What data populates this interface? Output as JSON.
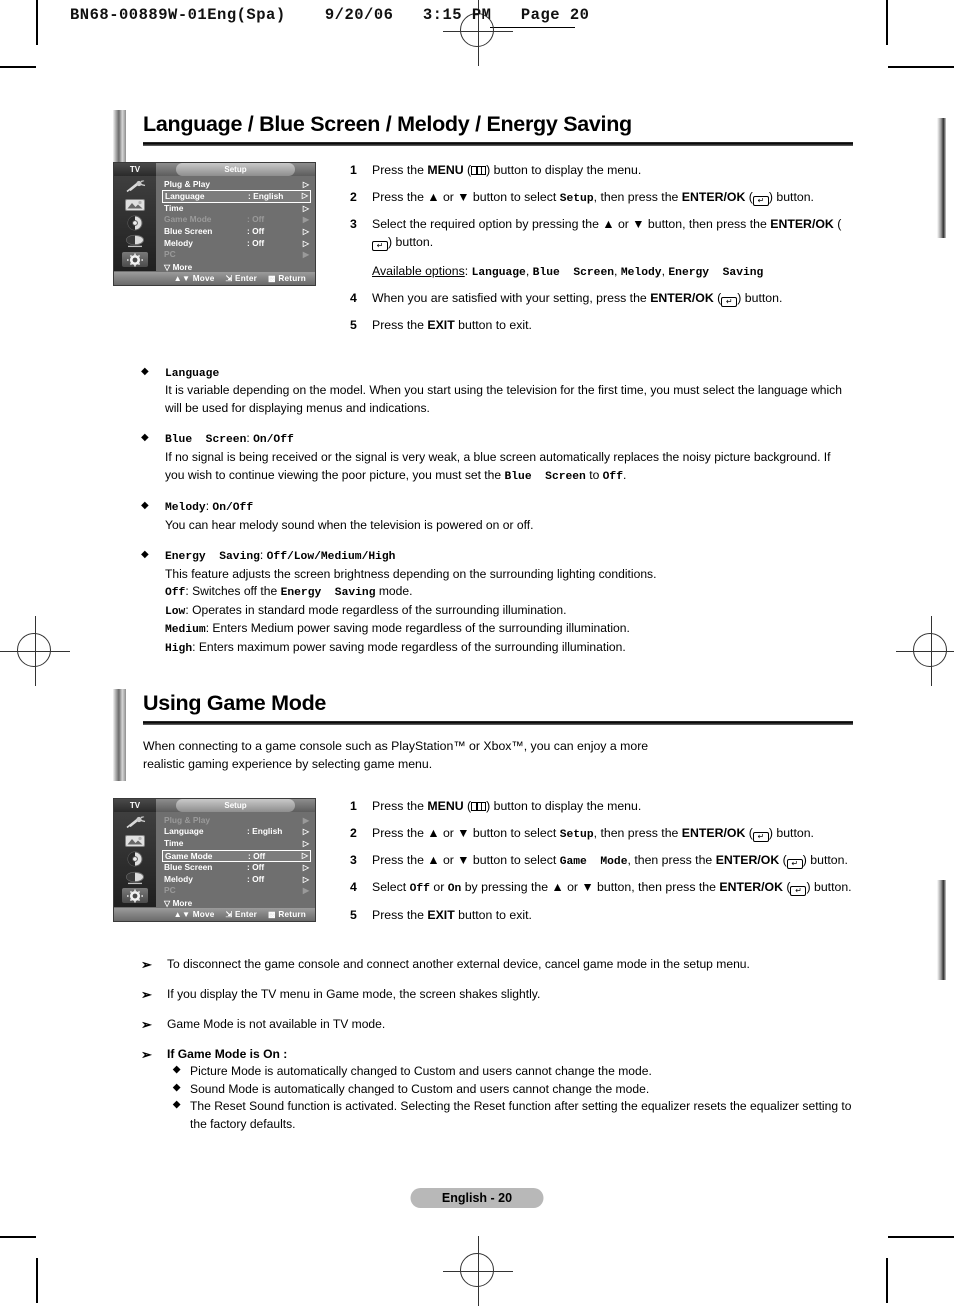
{
  "sheet_header": "BN68-00889W-01Eng(Spa)    9/20/06   3:15 PM   Page 20",
  "footer": {
    "page_label": "English - 20"
  },
  "sections": [
    {
      "title": "Language / Blue Screen / Melody / Energy Saving",
      "osd": {
        "tv_label": "TV",
        "title": "Setup",
        "more_label": "More",
        "rows": [
          {
            "name": "Plug & Play",
            "value": "",
            "arrow": "▷",
            "state": "normal"
          },
          {
            "name": "Language",
            "value": ": English",
            "arrow": "▷",
            "state": "highlight"
          },
          {
            "name": "Time",
            "value": "",
            "arrow": "▷",
            "state": "normal"
          },
          {
            "name": "Game Mode",
            "value": ": Off",
            "arrow": "▶",
            "state": "dim"
          },
          {
            "name": "Blue Screen",
            "value": ": Off",
            "arrow": "▷",
            "state": "normal"
          },
          {
            "name": "Melody",
            "value": ": Off",
            "arrow": "▷",
            "state": "normal"
          },
          {
            "name": "PC",
            "value": "",
            "arrow": "▶",
            "state": "dim"
          }
        ],
        "footer_keys": [
          {
            "icon": "updown-arrow-icon",
            "label": "Move"
          },
          {
            "icon": "enter-key-icon",
            "label": "Enter"
          },
          {
            "icon": "menu-key-icon",
            "label": "Return"
          }
        ],
        "side_icons": [
          "antenna-icon",
          "picture-icon",
          "sound-icon",
          "channel-icon",
          "setup-gear-icon"
        ]
      },
      "steps": [
        {
          "n": "1",
          "html": "Press the <b>MENU</b> (<span class=\"keycap-menu\"></span>) button to display the menu."
        },
        {
          "n": "2",
          "html": "Press the ▲ or ▼ button to select <span class=\"mono\">Setup</span>, then press the <b>ENTER/OK</b> (<span class=\"keycap-ent\">↵</span>) button."
        },
        {
          "n": "3",
          "html": "Select the required option by pressing the ▲ or ▼ button, then press the <b>ENTER/OK</b> (<span class=\"keycap-ent\">↵</span>) button.<div style=\"height:11px\"></div><span class=\"uline\">Available options</span>: <span class=\"mono\">Language</span>, <span class=\"mono\">Blue&nbsp;&nbsp;Screen</span>, <span class=\"mono\">Melody</span>, <span class=\"mono\">Energy&nbsp;&nbsp;Saving</span>"
        },
        {
          "n": "4",
          "html": "When you are satisfied with your setting, press the <b>ENTER/OK</b> (<span class=\"keycap-ent\">↵</span>) button."
        },
        {
          "n": "5",
          "html": "Press the <b>EXIT</b> button to exit."
        }
      ],
      "bullets": [
        {
          "marker": "◆",
          "html": "<span class=\"mono\">Language</span><br>It is variable depending on the model. When you start using the television for the first time, you must select the language which will be used for displaying menus and indications."
        },
        {
          "marker": "◆",
          "html": "<span class=\"mono\">Blue&nbsp;&nbsp;Screen</span>: <span class=\"mono\">On/Off</span><br>If no signal is being received or the signal is very weak, a blue screen automatically replaces the noisy picture background. If you wish to continue viewing the poor picture, you must set the <span class=\"mono\">Blue&nbsp;&nbsp;Screen</span> to <span class=\"mono\">Off</span>."
        },
        {
          "marker": "◆",
          "html": "<span class=\"mono\">Melody</span>: <span class=\"mono\">On/Off</span><br>You can hear melody sound when the television is powered on or off."
        },
        {
          "marker": "◆",
          "html": "<span class=\"mono\">Energy&nbsp;&nbsp;Saving</span>: <span class=\"mono\">Off/Low/Medium/High</span><br>This feature adjusts the screen brightness depending on the surrounding lighting conditions.<br><span class=\"mono\">Off</span>: Switches off the <span class=\"mono\">Energy&nbsp;&nbsp;Saving</span> mode.<br><span class=\"mono\">Low</span>: Operates in standard mode regardless of the surrounding illumination.<br><span class=\"mono\">Medium</span>: Enters Medium power saving mode regardless of the surrounding illumination.<br><span class=\"mono\">High</span>: Enters maximum power saving mode regardless of the surrounding illumination."
        }
      ]
    },
    {
      "title": "Using Game Mode",
      "intro": "When connecting to a game console such as PlayStation™ or Xbox™, you can enjoy a more realistic gaming experience by selecting game menu.",
      "osd": {
        "tv_label": "TV",
        "title": "Setup",
        "more_label": "More",
        "rows": [
          {
            "name": "Plug & Play",
            "value": "",
            "arrow": "▶",
            "state": "dim"
          },
          {
            "name": "Language",
            "value": ": English",
            "arrow": "▷",
            "state": "normal"
          },
          {
            "name": "Time",
            "value": "",
            "arrow": "▷",
            "state": "normal"
          },
          {
            "name": "Game Mode",
            "value": ": Off",
            "arrow": "▷",
            "state": "highlight"
          },
          {
            "name": "Blue Screen",
            "value": ": Off",
            "arrow": "▷",
            "state": "normal"
          },
          {
            "name": "Melody",
            "value": ": Off",
            "arrow": "▷",
            "state": "normal"
          },
          {
            "name": "PC",
            "value": "",
            "arrow": "▶",
            "state": "dim"
          }
        ],
        "footer_keys": [
          {
            "icon": "updown-arrow-icon",
            "label": "Move"
          },
          {
            "icon": "enter-key-icon",
            "label": "Enter"
          },
          {
            "icon": "menu-key-icon",
            "label": "Return"
          }
        ],
        "side_icons": [
          "antenna-icon",
          "picture-icon",
          "sound-icon",
          "channel-icon",
          "setup-gear-icon"
        ]
      },
      "steps": [
        {
          "n": "1",
          "html": "Press the <b>MENU</b> (<span class=\"keycap-menu\"></span>) button to display the menu."
        },
        {
          "n": "2",
          "html": "Press the ▲ or ▼ button to select <span class=\"mono\">Setup</span>, then press the <b>ENTER/OK</b> (<span class=\"keycap-ent\">↵</span>) button."
        },
        {
          "n": "3",
          "html": "Press the ▲ or ▼ button to select <span class=\"mono\">Game&nbsp;&nbsp;Mode</span>, then press the <b>ENTER/OK</b> (<span class=\"keycap-ent\">↵</span>) button."
        },
        {
          "n": "4",
          "html": "Select <span class=\"mono\">Off</span> or <span class=\"mono\">On</span> by pressing the ▲ or ▼ button, then press the <b>ENTER/OK</b> (<span class=\"keycap-ent\">↵</span>) button."
        },
        {
          "n": "5",
          "html": "Press the <b>EXIT</b> button to exit."
        }
      ],
      "notes": [
        {
          "marker": "➢",
          "html": "To disconnect the game console and connect another external device, cancel game mode in the setup menu."
        },
        {
          "marker": "➢",
          "html": "If you display the TV menu in Game mode, the screen shakes slightly."
        },
        {
          "marker": "➢",
          "html": "Game Mode is not available in TV mode."
        },
        {
          "marker": "➢",
          "html": "<b>If Game Mode is On :</b>",
          "subs": [
            {
              "marker": "◆",
              "text": "Picture Mode is automatically changed to Custom and users cannot change the mode."
            },
            {
              "marker": "◆",
              "text": "Sound Mode is automatically changed to Custom and users cannot change the mode."
            },
            {
              "marker": "◆",
              "text": "The Reset Sound function is activated. Selecting the Reset function after setting the equalizer resets the equalizer setting to the factory defaults."
            }
          ]
        }
      ]
    }
  ]
}
